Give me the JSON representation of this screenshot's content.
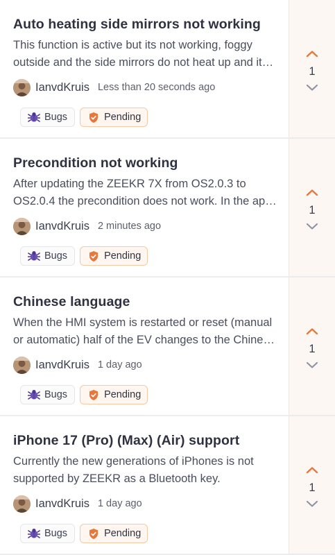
{
  "posts": [
    {
      "title": "Auto heating side mirrors not working",
      "description": "This function is active but its not working, foggy outside and the side mirrors do not heat up and it does not work at all when the weather is cold and humid in the morning.",
      "author": "IanvdKruis",
      "time": "Less than 20 seconds ago",
      "category": "Bugs",
      "status": "Pending",
      "votes": "1"
    },
    {
      "title": "Precondition not working",
      "description": "After updating the ZEEKR 7X from OS2.0.3 to OS2.0.4 the precondition does not work. In the app the schedule is set but the car does not start the climate control.",
      "author": "IanvdKruis",
      "time": "2 minutes ago",
      "category": "Bugs",
      "status": "Pending",
      "votes": "1"
    },
    {
      "title": "Chinese language",
      "description": "When the HMI system is restarted or reset (manual or automatic) half of the EV changes to the Chinese language and the menus are no longer readable.",
      "author": "IanvdKruis",
      "time": "1 day ago",
      "category": "Bugs",
      "status": "Pending",
      "votes": "1"
    },
    {
      "title": "iPhone 17 (Pro) (Max) (Air) support",
      "description": "Currently the new generations of iPhones is not supported by ZEEKR as a Bluetooth key.",
      "author": "IanvdKruis",
      "time": "1 day ago",
      "category": "Bugs",
      "status": "Pending",
      "votes": "1"
    }
  ],
  "icons": {
    "category": "bug-icon",
    "status": "shield-check-icon",
    "upvote": "chevron-up-icon",
    "downvote": "chevron-down-icon"
  },
  "colors": {
    "accent": "#e8773c",
    "pending_border": "#f4c9a6",
    "bug_purple": "#6b4fb8",
    "vote_panel": "#fdf7f3"
  }
}
